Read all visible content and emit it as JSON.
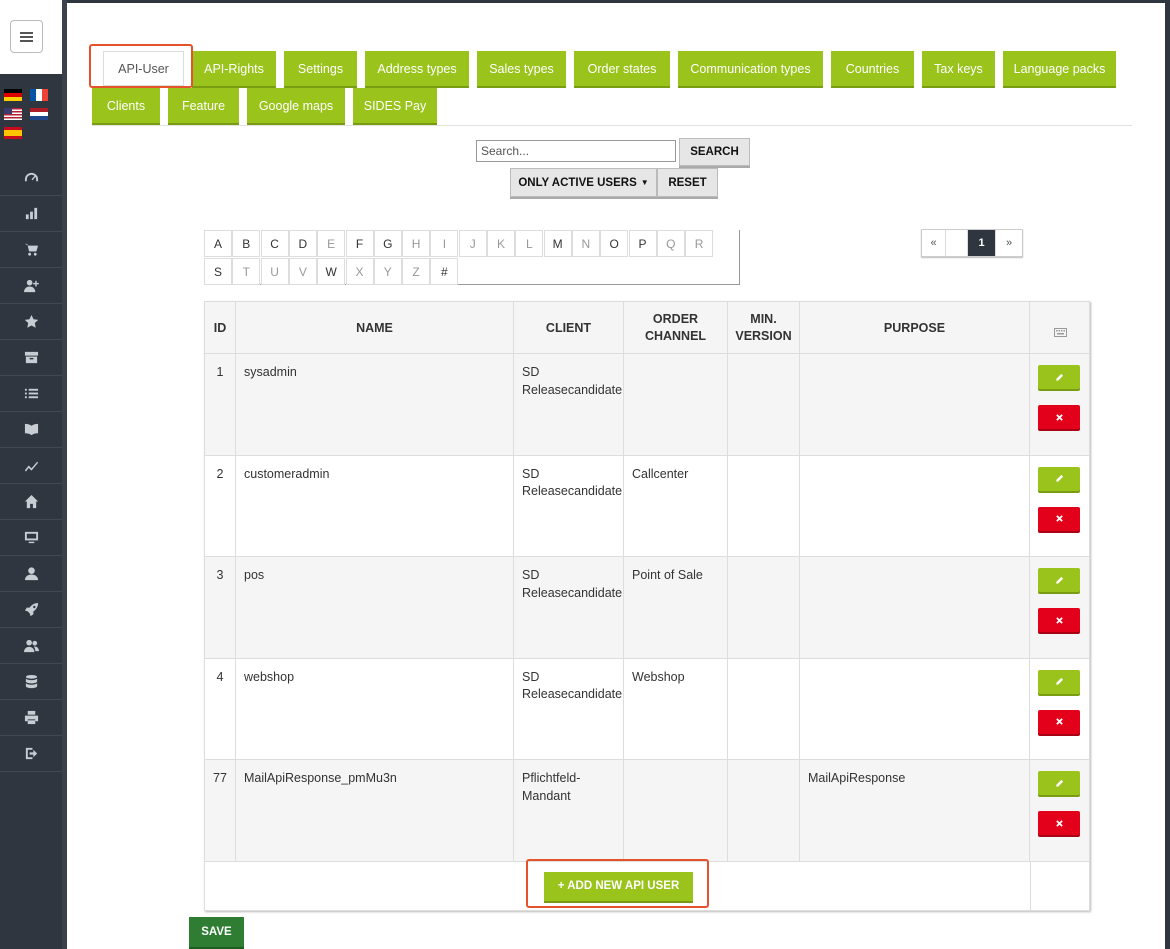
{
  "tabs": [
    {
      "label": "API-User",
      "active": true
    },
    {
      "label": "API-Rights"
    },
    {
      "label": "Settings"
    },
    {
      "label": "Address types"
    },
    {
      "label": "Sales types"
    },
    {
      "label": "Order states"
    },
    {
      "label": "Communication types"
    },
    {
      "label": "Countries"
    },
    {
      "label": "Tax keys"
    },
    {
      "label": "Language packs"
    },
    {
      "label": "Clients"
    },
    {
      "label": "Feature"
    },
    {
      "label": "Google maps"
    },
    {
      "label": "SIDES Pay"
    }
  ],
  "search": {
    "placeholder": "Search...",
    "value": "",
    "button": "SEARCH"
  },
  "filter": {
    "dropdown_label": "ONLY ACTIVE USERS",
    "reset": "RESET"
  },
  "alphabet": [
    "A",
    "B",
    "C",
    "D",
    "E",
    "F",
    "G",
    "H",
    "I",
    "J",
    "K",
    "L",
    "M",
    "N",
    "O",
    "P",
    "Q",
    "R",
    "S",
    "T",
    "U",
    "V",
    "W",
    "X",
    "Y",
    "Z",
    "#"
  ],
  "alphabet_dim": [
    "E",
    "H",
    "I",
    "J",
    "K",
    "L",
    "N",
    "Q",
    "R",
    "T",
    "U",
    "V",
    "X",
    "Y",
    "Z"
  ],
  "pagination": {
    "prev": "«",
    "current": "1",
    "next": "»"
  },
  "table": {
    "headers": {
      "id": "ID",
      "name": "NAME",
      "client": "CLIENT",
      "order_channel": "ORDER CHANNEL",
      "min_version": "MIN. VERSION",
      "purpose": "PURPOSE"
    },
    "rows": [
      {
        "id": "1",
        "name": "sysadmin",
        "client": "SD Releasecandidate",
        "order_channel": "",
        "min_version": "",
        "purpose": ""
      },
      {
        "id": "2",
        "name": "customeradmin",
        "client": "SD Releasecandidate",
        "order_channel": "Callcenter",
        "min_version": "",
        "purpose": ""
      },
      {
        "id": "3",
        "name": "pos",
        "client": "SD Releasecandidate",
        "order_channel": "Point of Sale",
        "min_version": "",
        "purpose": ""
      },
      {
        "id": "4",
        "name": "webshop",
        "client": "SD Releasecandidate",
        "order_channel": "Webshop",
        "min_version": "",
        "purpose": ""
      },
      {
        "id": "77",
        "name": "MailApiResponse_pmMu3n",
        "client": "Pflichtfeld-Mandant",
        "order_channel": "",
        "min_version": "",
        "purpose": "MailApiResponse"
      }
    ],
    "add_button": "+ ADD NEW API USER"
  },
  "save_button": "SAVE",
  "colors": {
    "accent_green": "#9ac31c",
    "delete_red": "#e3001b",
    "save_green": "#2e7d32",
    "sidebar": "#2f3640",
    "highlight": "#e5532d"
  },
  "icons": {
    "sidebar": [
      "dashboard-icon",
      "bar-chart-icon",
      "cart-icon",
      "add-user-icon",
      "star-icon",
      "archive-icon",
      "list-icon",
      "book-icon",
      "line-chart-icon",
      "home-icon",
      "monitor-icon",
      "user-icon",
      "rocket-icon",
      "users-icon",
      "database-icon",
      "print-icon",
      "logout-icon"
    ],
    "table_header_action": "keyboard-icon",
    "edit": "pencil-icon",
    "delete": "x-icon"
  }
}
